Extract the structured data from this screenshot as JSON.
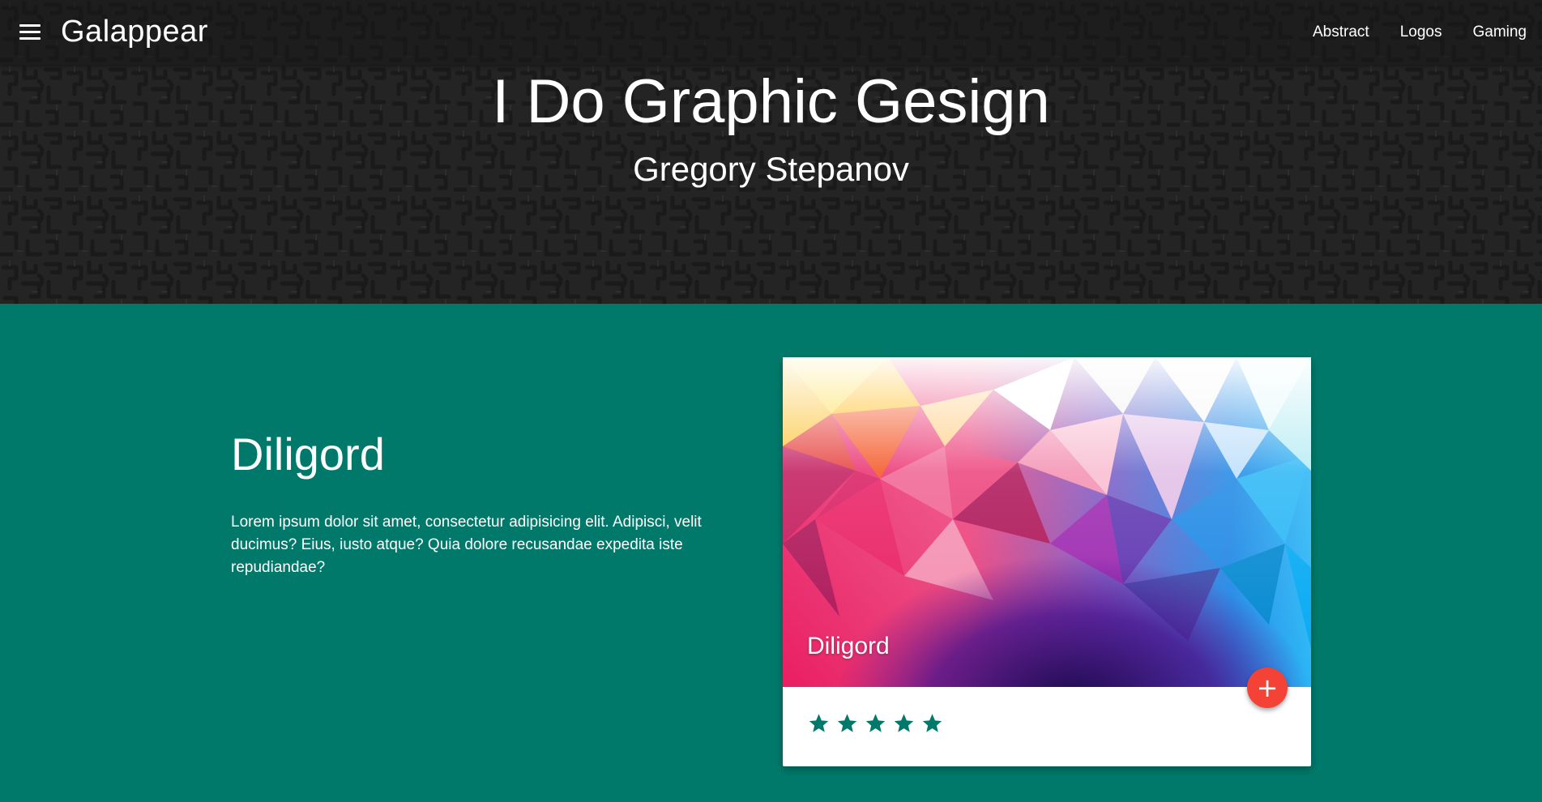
{
  "navbar": {
    "menu_icon": "menu-icon",
    "brand": "Galappear",
    "links": [
      "Abstract",
      "Logos",
      "Gaming"
    ]
  },
  "hero": {
    "title": "I Do Graphic Gesign",
    "subtitle": "Gregory Stepanov"
  },
  "content": {
    "heading": "Diligord",
    "text": "Lorem ipsum dolor sit amet, consectetur adipisicing elit. Adipisci, velit ducimus? Eius, iusto atque? Quia dolore recusandae expedita iste repudiandae?"
  },
  "card": {
    "title": "Diligord",
    "fab_label": "+",
    "rating": 5,
    "rating_max": 5
  },
  "colors": {
    "teal": "#00796b",
    "fab": "#f44336",
    "star": "#00796b",
    "hero_bg": "#242424"
  }
}
